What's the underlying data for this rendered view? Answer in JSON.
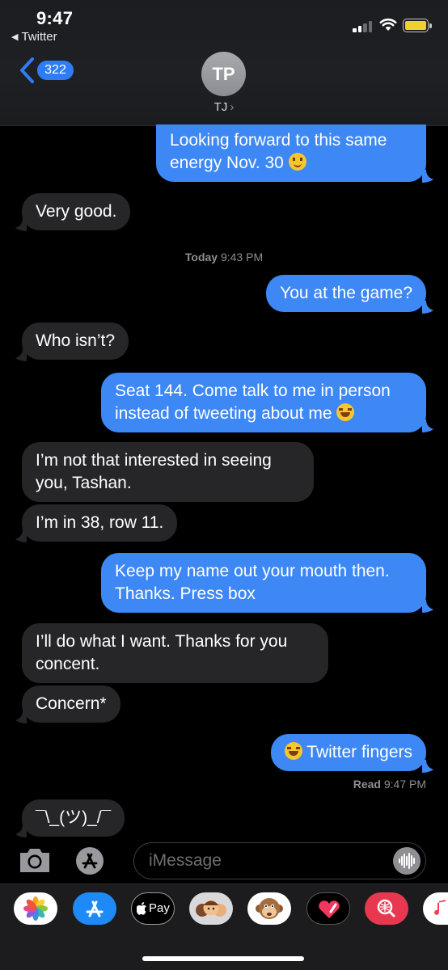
{
  "status_bar": {
    "time": "9:47",
    "back_app": "Twitter",
    "battery_color": "#f3cf2b"
  },
  "nav": {
    "back_count": "322",
    "avatar_initials": "TP",
    "contact_name": "TJ",
    "accent_color": "#2f7df6"
  },
  "messages": [
    {
      "direction": "outgoing",
      "text": "Looking forward to this same",
      "text2": "energy Nov. 30",
      "emoji": "hugging-face-emoji"
    },
    {
      "direction": "incoming",
      "text": "Very good."
    },
    {
      "direction": "outgoing",
      "text": "You at the game?"
    },
    {
      "direction": "incoming",
      "text": "Who isn’t?"
    },
    {
      "direction": "outgoing",
      "text": "Seat 144. Come talk to me in person",
      "text2": "instead of tweeting about me",
      "emoji": "tears-of-joy-emoji"
    },
    {
      "direction": "incoming",
      "text": "I’m not that interested in seeing",
      "text2": "you, Tashan."
    },
    {
      "direction": "incoming",
      "text": "I’m in 38, row 11."
    },
    {
      "direction": "outgoing",
      "text": "Keep my name out your mouth then.",
      "text2": "Thanks. Press box"
    },
    {
      "direction": "incoming",
      "text": "I’ll do what I want. Thanks for you",
      "text2": "concent."
    },
    {
      "direction": "incoming",
      "text": "Concern*"
    },
    {
      "direction": "outgoing",
      "text": "Twitter fingers",
      "emoji": "tears-of-joy-emoji"
    },
    {
      "direction": "incoming",
      "text": "¯\\_(ツ)_/¯"
    }
  ],
  "timestamp": {
    "day": "Today",
    "time": "9:43 PM"
  },
  "read_receipt": {
    "label": "Read",
    "time": "9:47 PM"
  },
  "composer": {
    "placeholder": "iMessage"
  },
  "drawer_apps": [
    "photos-icon",
    "app-store-icon",
    "apple-pay-icon",
    "memoji-icon",
    "animoji-monkey-icon",
    "digital-touch-icon",
    "images-search-icon",
    "music-icon"
  ],
  "apple_pay_label": "Pay",
  "colors": {
    "outgoing_bubble": "#3d88f5",
    "incoming_bubble": "#262628",
    "background": "#000000"
  }
}
